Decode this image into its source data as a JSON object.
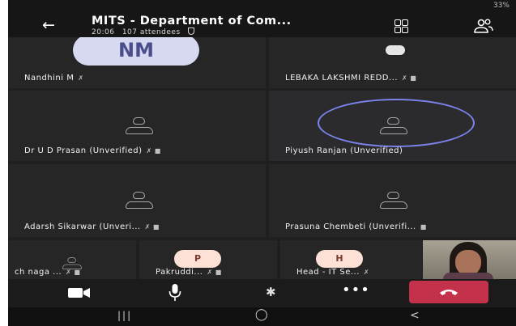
{
  "status": {
    "battery": "33%"
  },
  "meeting": {
    "title": "MITS - Department of Com...",
    "time": "20:06",
    "attendees": "107 attendees"
  },
  "tiles": [
    {
      "name": "Nandhini M",
      "avatar_initials": "NM"
    },
    {
      "name": "LEBAKA LAKSHMI REDD..."
    },
    {
      "name": "Dr U D Prasan (Unverified)"
    },
    {
      "name": "Piyush Ranjan (Unverified)"
    },
    {
      "name": "Adarsh Sikarwar  (Unveri..."
    },
    {
      "name": "Prasuna Chembeti (Unverifi..."
    },
    {
      "name": "ch naga ..."
    },
    {
      "name": "Pakruddi...",
      "avatar_initials": "P"
    },
    {
      "name": "Head - IT Se...",
      "avatar_initials": "H"
    }
  ],
  "nav": {
    "recent": "|||",
    "home": "◯",
    "back": "<"
  },
  "colors": {
    "accent_ring": "#7b83eb",
    "leave": "#c4314b",
    "avatar_bg": "#fde1d6",
    "nm_avatar_bg": "#d7d9f0"
  }
}
